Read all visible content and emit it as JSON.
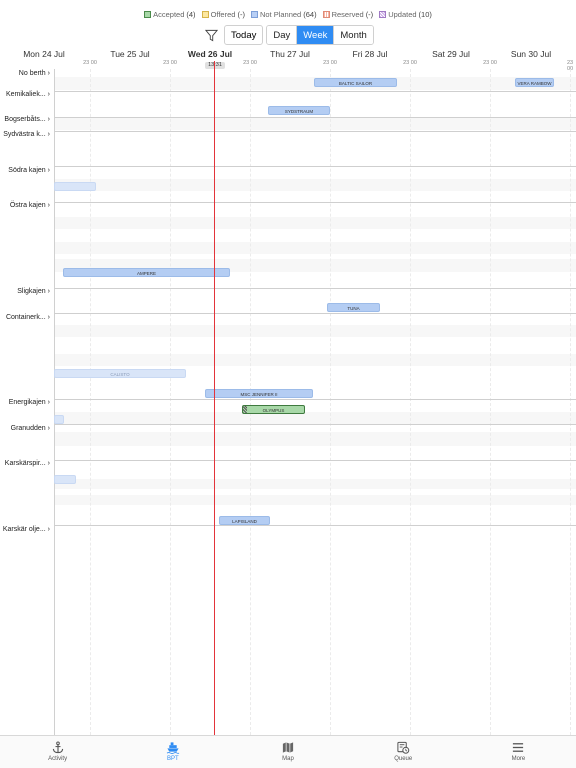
{
  "legend": [
    {
      "label": "Accepted",
      "count": "(4)",
      "cls": "sw-accepted"
    },
    {
      "label": "Offered",
      "count": "(-)",
      "cls": "sw-offered"
    },
    {
      "label": "Not Planned",
      "count": "(64)",
      "cls": "sw-notplanned"
    },
    {
      "label": "Reserved",
      "count": "(-)",
      "cls": "sw-reserved"
    },
    {
      "label": "Updated",
      "count": "(10)",
      "cls": "sw-updated"
    }
  ],
  "toolbar": {
    "today": "Today",
    "day": "Day",
    "week": "Week",
    "month": "Month",
    "active_view": "week"
  },
  "timeline": {
    "days": [
      {
        "label": "Mon 24 Jul",
        "bold": false
      },
      {
        "label": "Tue 25 Jul",
        "bold": false
      },
      {
        "label": "Wed 26 Jul",
        "bold": true
      },
      {
        "label": "Thu 27 Jul",
        "bold": false
      },
      {
        "label": "Fri 28 Jul",
        "bold": false
      },
      {
        "label": "Sat 29 Jul",
        "bold": false
      },
      {
        "label": "Sun 30 Jul",
        "bold": false
      }
    ],
    "hour_label": "23 00",
    "now": "13:31"
  },
  "berths": [
    "No berth",
    "Kemikaliek...",
    "Bogserbåts...",
    "Sydvästra k...",
    "Södra kajen",
    "Östra kajen",
    "Sligkajen",
    "Containerk...",
    "Energikajen",
    "Granudden",
    "Karskärspir...",
    "Karskär olje..."
  ],
  "vessels": [
    {
      "name": "BALTIC SAILOR",
      "status": "not-planned"
    },
    {
      "name": "VERA RAMBOW",
      "status": "not-planned"
    },
    {
      "name": "SYDSTRAUM",
      "status": "not-planned"
    },
    {
      "name": "",
      "status": "not-planned-faded"
    },
    {
      "name": "AMPERE",
      "status": "not-planned"
    },
    {
      "name": "TUNA",
      "status": "not-planned"
    },
    {
      "name": "CALISTO",
      "status": "not-planned-faded"
    },
    {
      "name": "MSC JENNIFER II",
      "status": "not-planned"
    },
    {
      "name": "OLYMPUS",
      "status": "accepted"
    },
    {
      "name": "",
      "status": "not-planned-faded"
    },
    {
      "name": "",
      "status": "not-planned-faded"
    },
    {
      "name": "LAPISLAND",
      "status": "not-planned"
    }
  ],
  "tabs": [
    {
      "label": "Activity",
      "icon": "anchor-icon"
    },
    {
      "label": "BPT",
      "icon": "ship-icon",
      "active": true
    },
    {
      "label": "Map",
      "icon": "map-icon"
    },
    {
      "label": "Queue",
      "icon": "queue-icon"
    },
    {
      "label": "More",
      "icon": "menu-icon"
    }
  ]
}
